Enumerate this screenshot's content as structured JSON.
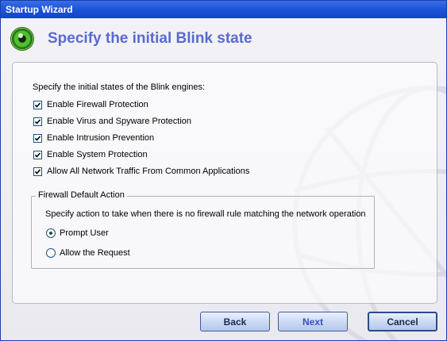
{
  "window": {
    "title": "Startup Wizard"
  },
  "header": {
    "heading": "Specify the initial Blink state",
    "logo_icon": "blink-eye-icon"
  },
  "engines": {
    "intro": "Specify the initial states of the Blink engines:",
    "items": [
      {
        "label": "Enable Firewall Protection",
        "checked": true
      },
      {
        "label": "Enable Virus and Spyware Protection",
        "checked": true
      },
      {
        "label": "Enable Intrusion Prevention",
        "checked": true
      },
      {
        "label": "Enable System Protection",
        "checked": true
      },
      {
        "label": "Allow All Network Traffic From Common Applications",
        "checked": true
      }
    ]
  },
  "firewall_default": {
    "title": "Firewall Default Action",
    "description": "Specify action to take when there is no firewall rule matching the network operation",
    "options": [
      {
        "label": "Prompt User",
        "selected": true
      },
      {
        "label": "Allow the Request",
        "selected": false
      }
    ]
  },
  "buttons": {
    "back": "Back",
    "next": "Next",
    "cancel": "Cancel"
  },
  "colors": {
    "titlebar": "#1f55d8",
    "heading": "#5a6ad0",
    "accent_green": "#4fbf2f"
  }
}
